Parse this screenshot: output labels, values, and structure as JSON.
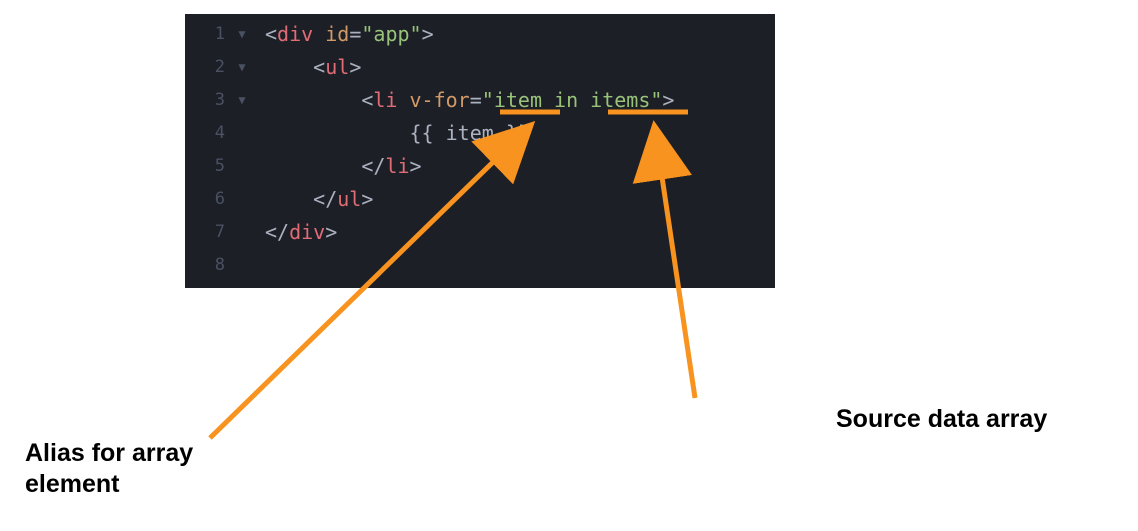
{
  "code": {
    "lines": [
      1,
      2,
      3,
      4,
      5,
      6,
      7,
      8
    ],
    "folds": [
      true,
      true,
      true,
      false,
      false,
      false,
      false,
      false
    ],
    "l1": {
      "lt": "<",
      "div": "div",
      "sp": " ",
      "id": "id",
      "eq": "=",
      "q1": "\"",
      "val": "app",
      "q2": "\"",
      "gt": ">"
    },
    "l2": {
      "pad": "    ",
      "lt": "<",
      "ul": "ul",
      "gt": ">"
    },
    "l3": {
      "pad": "        ",
      "lt": "<",
      "li": "li",
      "sp": " ",
      "vfor": "v-for",
      "eq": "=",
      "q1": "\"",
      "val": "item in items",
      "q2": "\"",
      "gt": ">"
    },
    "l4": {
      "pad": "            ",
      "expr": "{{ item }}"
    },
    "l5": {
      "pad": "        ",
      "lt": "</",
      "li": "li",
      "gt": ">"
    },
    "l6": {
      "pad": "    ",
      "lt": "</",
      "ul": "ul",
      "gt": ">"
    },
    "l7": {
      "lt": "</",
      "div": "div",
      "gt": ">"
    }
  },
  "labels": {
    "alias": "Alias for array element",
    "source": "Source data array"
  },
  "colors": {
    "arrow": "#f7931e"
  }
}
